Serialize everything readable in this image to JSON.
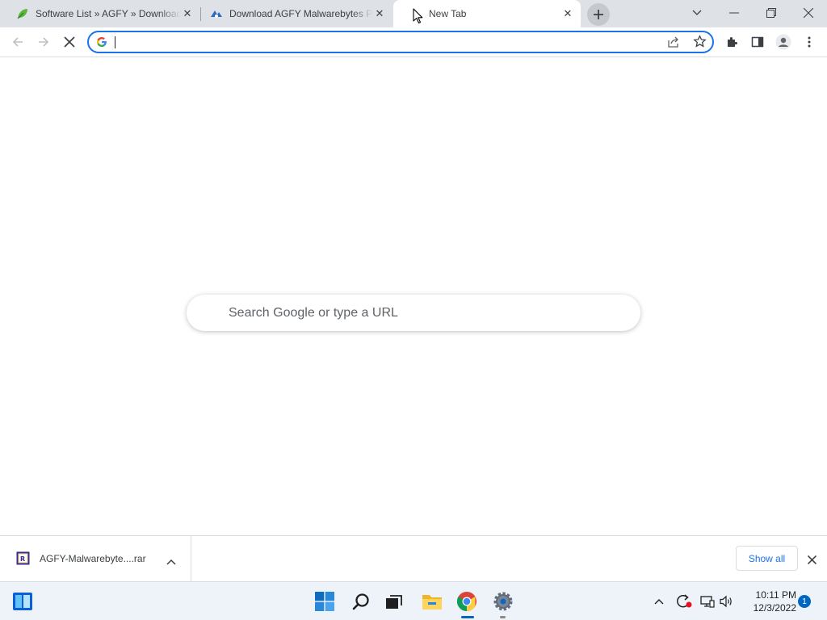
{
  "browser": {
    "tabs": [
      {
        "title": "Software List » AGFY » Download",
        "favicon": "leaf-icon",
        "active": false
      },
      {
        "title": "Download AGFY Malwarebytes Premium",
        "favicon": "agfy-logo-icon",
        "active": false
      },
      {
        "title": "New Tab",
        "favicon": "loading-icon",
        "active": true
      }
    ],
    "omnibox": {
      "value": "",
      "search_engine_icon": "google-g-icon"
    }
  },
  "newtab": {
    "search_placeholder": "Search Google or type a URL"
  },
  "downloads": {
    "items": [
      {
        "filename": "AGFY-Malwarebyte....rar",
        "icon": "rar-archive-icon"
      }
    ],
    "show_all_label": "Show all"
  },
  "taskbar": {
    "time": "10:11 PM",
    "date": "12/3/2022",
    "notification_count": "1",
    "pinned_apps": [
      "widgets-icon",
      "start-icon",
      "search-icon",
      "task-view-icon",
      "file-explorer-icon",
      "chrome-icon",
      "settings-icon"
    ]
  },
  "colors": {
    "accent": "#1a73e8",
    "tabstrip_bg": "#dee1e6",
    "taskbar_bg": "#eef2f9"
  }
}
